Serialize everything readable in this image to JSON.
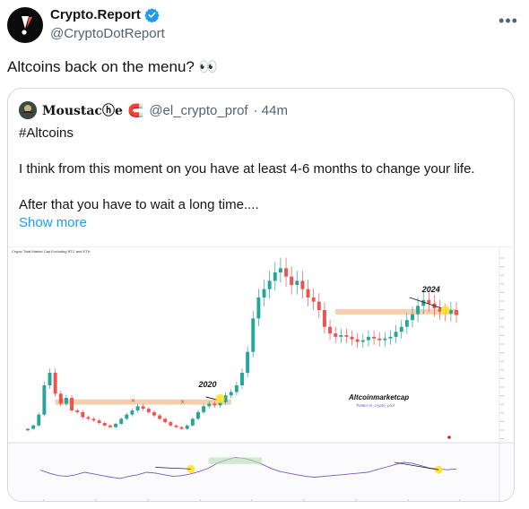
{
  "tweet": {
    "display_name": "Crypto.Report",
    "handle": "@CryptoDotReport",
    "text": "Altcoins back on the menu? 👀",
    "more_label": "•••"
  },
  "quote": {
    "display_name": "Moustacⓗe",
    "magnet": "🧲",
    "handle": "@el_crypto_prof",
    "time": "· 44m",
    "lines": [
      "#Altcoins",
      "I think from this moment on you have at least 4-6 months to change your life.",
      "After that you have to wait a long time...."
    ],
    "show_more": "Show more"
  },
  "chart_data": {
    "type": "candlestick",
    "title": "Crypto Total Market Cap Excluding BTC and ETH",
    "annotations": [
      "2020",
      "2024"
    ],
    "watermark": "Altcoinmarketcap",
    "watermark_sub": "Twitter:el_crypto_prof",
    "close_series": [
      18,
      22,
      35,
      70,
      85,
      60,
      48,
      55,
      40,
      38,
      32,
      30,
      28,
      25,
      22,
      20,
      24,
      30,
      35,
      40,
      45,
      42,
      38,
      34,
      30,
      26,
      22,
      20,
      18,
      22,
      30,
      38,
      45,
      48,
      46,
      50,
      58,
      62,
      70,
      85,
      110,
      150,
      175,
      185,
      195,
      205,
      210,
      200,
      190,
      195,
      185,
      175,
      170,
      160,
      140,
      132,
      128,
      130,
      128,
      125,
      122,
      124,
      128,
      126,
      124,
      126,
      128,
      134,
      140,
      148,
      155,
      165,
      172,
      168,
      162,
      158,
      156,
      160,
      154
    ],
    "support_levels": [
      {
        "label": "range-2019-2020",
        "value": 50
      },
      {
        "label": "range-2022-2024",
        "value": 158
      }
    ],
    "rsi_series": [
      55,
      48,
      42,
      40,
      44,
      50,
      46,
      42,
      38,
      35,
      40,
      44,
      50,
      48,
      44,
      40,
      42,
      46,
      52,
      60,
      72,
      80,
      86,
      84,
      78,
      70,
      60,
      52,
      48,
      44,
      40,
      38,
      40,
      42,
      44,
      46,
      48,
      50,
      56,
      62,
      68,
      74,
      72,
      66,
      60,
      58,
      56,
      58
    ],
    "colors": {
      "up": "#26a69a",
      "down": "#ef5350",
      "band": "#f5c8a0",
      "rsi": "#7e57c2",
      "highlight": "#ffe32a"
    }
  }
}
